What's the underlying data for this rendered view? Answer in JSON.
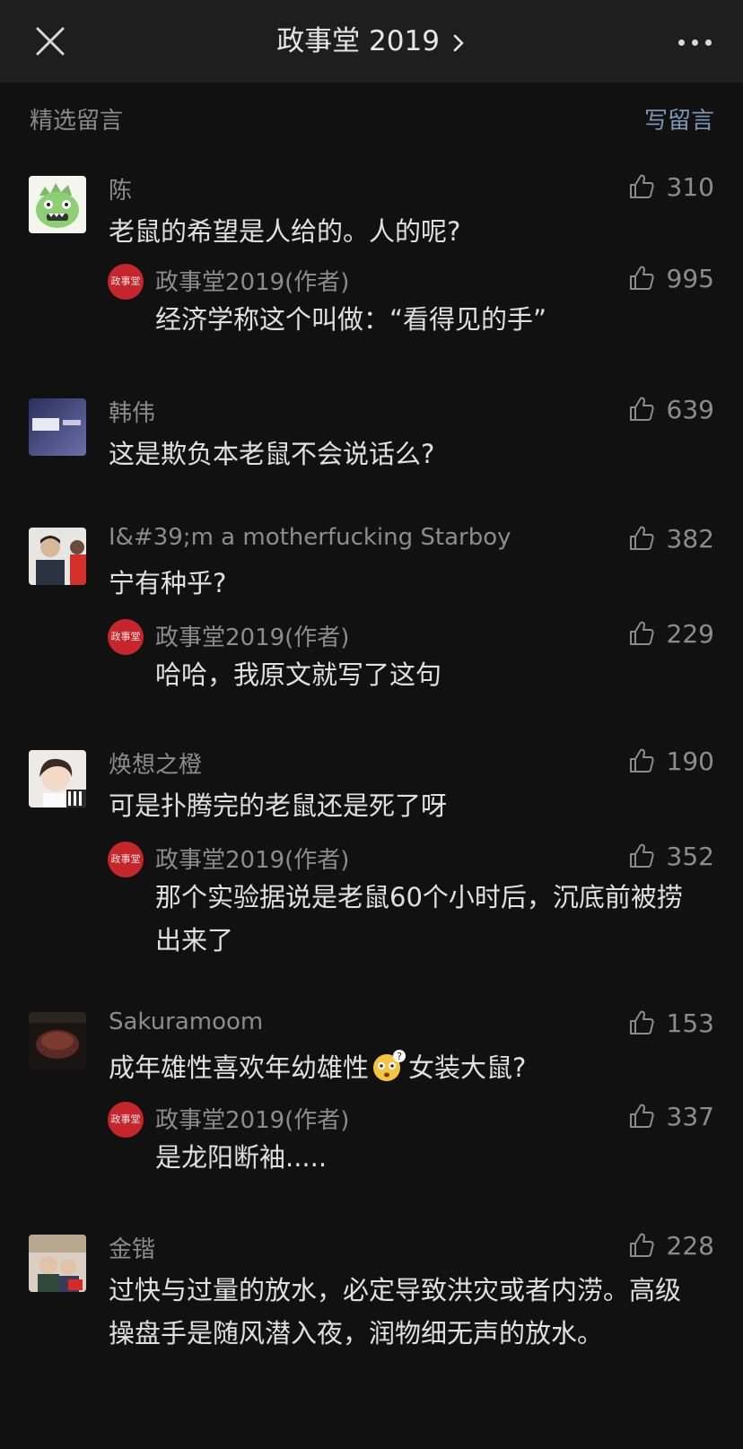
{
  "header": {
    "title": "政事堂 2019",
    "close_icon": "close-icon",
    "more_icon": "more-icon"
  },
  "section": {
    "title": "精选留言",
    "write_label": "写留言"
  },
  "comments": [
    {
      "nickname": "陈",
      "likes": "310",
      "text": "老鼠的希望是人给的。人的呢?",
      "reply": {
        "nickname": "政事堂2019(作者)",
        "likes": "995",
        "text": "经济学称这个叫做：“看得见的手”"
      }
    },
    {
      "nickname": "韩伟",
      "likes": "639",
      "text": "这是欺负本老鼠不会说话么?"
    },
    {
      "nickname": "I&#39;m a motherfucking Starboy",
      "likes": "382",
      "text": "宁有种乎?",
      "reply": {
        "nickname": "政事堂2019(作者)",
        "likes": "229",
        "text": "哈哈，我原文就写了这句"
      }
    },
    {
      "nickname": "焕想之橙",
      "likes": "190",
      "text": "可是扑腾完的老鼠还是死了呀",
      "reply": {
        "nickname": "政事堂2019(作者)",
        "likes": "352",
        "text": "那个实验据说是老鼠60个小时后，沉底前被捞出来了"
      }
    },
    {
      "nickname": "Sakuramoom",
      "likes": "153",
      "text_before": "成年雄性喜欢年幼雄性",
      "text_after": "女装大鼠?",
      "emoji": "confused-emoji",
      "reply": {
        "nickname": "政事堂2019(作者)",
        "likes": "337",
        "text": "是龙阳断袖....."
      }
    },
    {
      "nickname": "金锴",
      "likes": "228",
      "text": "过快与过量的放水，必定导致洪灾或者内涝。高级操盘手是随风潜入夜，润物细无声的放水。"
    }
  ],
  "author_avatar_text": "政事堂",
  "colors": {
    "background": "#111111",
    "topbar": "#1e1e1e",
    "link": "#7e96b6",
    "author_badge": "#c4262b"
  }
}
